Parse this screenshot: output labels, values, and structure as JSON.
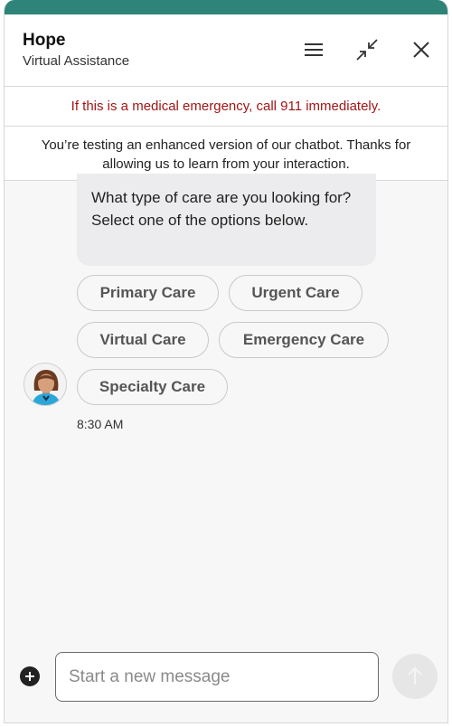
{
  "header": {
    "title": "Hope",
    "subtitle": "Virtual Assistance",
    "icons": {
      "menu": "hamburger-menu-icon",
      "minimize": "minimize-arrows-icon",
      "close": "close-icon"
    }
  },
  "alerts": {
    "emergency": "If this is a medical emergency, call 911 immediately.",
    "notice": "You’re testing an enhanced version of our chatbot. Thanks for allowing us to learn from your interaction."
  },
  "chat": {
    "message": "What type of care are you looking for? Select one of the options below.",
    "options": [
      "Primary Care",
      "Urgent Care",
      "Virtual Care",
      "Emergency Care",
      "Specialty Care"
    ],
    "timestamp": "8:30 AM"
  },
  "composer": {
    "placeholder": "Start a new message",
    "value": ""
  },
  "colors": {
    "brand": "#2e8478",
    "emergency_text": "#a31515",
    "avatar_shirt": "#2aa7d8"
  }
}
